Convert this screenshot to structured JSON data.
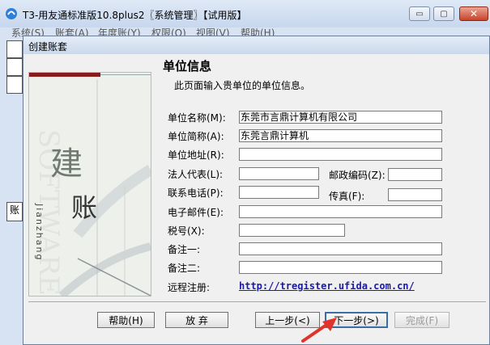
{
  "window": {
    "title": "T3-用友通标准版10.8plus2〖系统管理〗【试用版】",
    "controls": {
      "minimize": "▭",
      "maximize": "▢",
      "close": "✕"
    }
  },
  "menu": [
    {
      "label": "系统(S)"
    },
    {
      "label": "账套(A)"
    },
    {
      "label": "年度账(Y)"
    },
    {
      "label": "权限(O)"
    },
    {
      "label": "视图(V)"
    },
    {
      "label": "帮助(H)"
    }
  ],
  "background": {
    "partial_label": "账"
  },
  "dialog": {
    "title": "创建账套",
    "side_panel": {
      "char1": "建",
      "char2": "账",
      "vertical_text": "Jianzhang",
      "watermark": "SOFTWARE"
    },
    "section_title": "单位信息",
    "section_desc": "此页面输入贵单位的单位信息。",
    "fields": {
      "name": {
        "label": "单位名称(M):",
        "value": "东莞市言鼎计算机有限公司"
      },
      "short_name": {
        "label": "单位简称(A):",
        "value": "东莞言鼎计算机"
      },
      "address": {
        "label": "单位地址(R):",
        "value": ""
      },
      "legal_rep": {
        "label": "法人代表(L):",
        "value": ""
      },
      "postcode": {
        "label": "邮政编码(Z):",
        "value": ""
      },
      "phone": {
        "label": "联系电话(P):",
        "value": ""
      },
      "fax": {
        "label": "传真(F):",
        "value": ""
      },
      "email": {
        "label": "电子邮件(E):",
        "value": ""
      },
      "tax_no": {
        "label": "税号(X):",
        "value": ""
      },
      "note1": {
        "label": "备注一:",
        "value": ""
      },
      "note2": {
        "label": "备注二:",
        "value": ""
      }
    },
    "remote_register": {
      "label": "远程注册:",
      "link": "http://tregister.ufida.com.cn/"
    },
    "buttons": {
      "help": "帮助(H)",
      "cancel": "放 弃",
      "prev": "上一步(<)",
      "next": "下一步(>)",
      "finish": "完成(F)"
    }
  },
  "colors": {
    "accent_red": "#8a1b1b",
    "link_blue": "#1a1aa8",
    "arrow_red": "#e0342a"
  }
}
